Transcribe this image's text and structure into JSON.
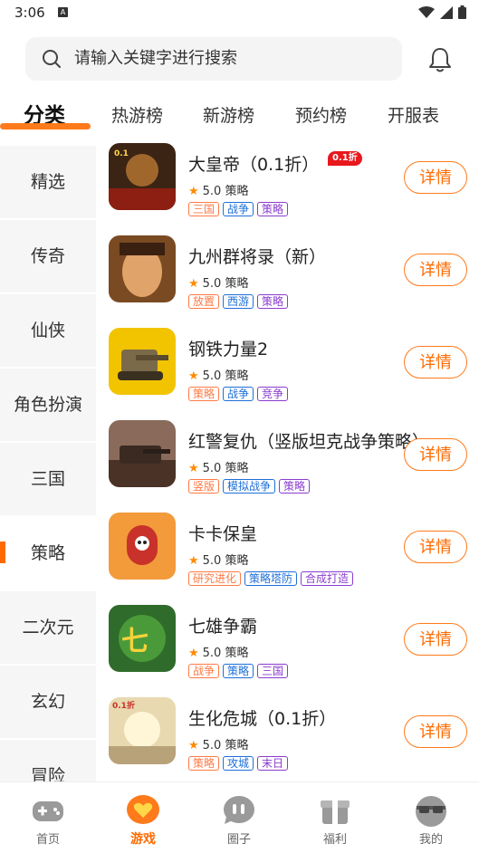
{
  "status_bar": {
    "time": "3:06",
    "notif": "A"
  },
  "search": {
    "placeholder": "请输入关键字进行搜索"
  },
  "top_tabs": [
    "分类",
    "热游榜",
    "新游榜",
    "预约榜",
    "开服表"
  ],
  "sidebar": {
    "items": [
      "精选",
      "传奇",
      "仙侠",
      "角色扮演",
      "三国",
      "策略",
      "二次元",
      "玄幻",
      "冒险"
    ],
    "active": "策略"
  },
  "games": [
    {
      "name": "大皇帝（0.1折）",
      "rating": "5.0",
      "genre": "策略",
      "badge": "0.1折",
      "tags": [
        {
          "text": "三国",
          "color": "#ff7a45"
        },
        {
          "text": "战争",
          "color": "#1e6fd9"
        },
        {
          "text": "策略",
          "color": "#8a3ccf"
        }
      ],
      "button": "详情",
      "icon_color": "#6b3a1e"
    },
    {
      "name": "九州群将录（新）",
      "rating": "5.0",
      "genre": "策略",
      "tags": [
        {
          "text": "放置",
          "color": "#ff7a45"
        },
        {
          "text": "西游",
          "color": "#1e6fd9"
        },
        {
          "text": "策略",
          "color": "#8a3ccf"
        }
      ],
      "button": "详情",
      "icon_color": "#c98a4a"
    },
    {
      "name": "钢铁力量2",
      "rating": "5.0",
      "genre": "策略",
      "tags": [
        {
          "text": "策略",
          "color": "#ff7a45"
        },
        {
          "text": "战争",
          "color": "#1e6fd9"
        },
        {
          "text": "竞争",
          "color": "#8a3ccf"
        }
      ],
      "button": "详情",
      "icon_color": "#f2c400"
    },
    {
      "name": "红警复仇（竖版坦克战争策略）",
      "rating": "5.0",
      "genre": "策略",
      "tags": [
        {
          "text": "竖版",
          "color": "#ff7a45"
        },
        {
          "text": "模拟战争",
          "color": "#1e6fd9"
        },
        {
          "text": "策略",
          "color": "#8a3ccf"
        }
      ],
      "button": "详情",
      "icon_color": "#5a3a2a"
    },
    {
      "name": "卡卡保皇",
      "rating": "5.0",
      "genre": "策略",
      "tags": [
        {
          "text": "研究进化",
          "color": "#ff7a45"
        },
        {
          "text": "策略塔防",
          "color": "#1e6fd9"
        },
        {
          "text": "合成打造",
          "color": "#8a3ccf"
        }
      ],
      "button": "详情",
      "icon_color": "#f39a3a"
    },
    {
      "name": "七雄争霸",
      "rating": "5.0",
      "genre": "策略",
      "tags": [
        {
          "text": "战争",
          "color": "#ff7a45"
        },
        {
          "text": "策略",
          "color": "#1e6fd9"
        },
        {
          "text": "三国",
          "color": "#8a3ccf"
        }
      ],
      "button": "详情",
      "icon_color": "#2f6b2a"
    },
    {
      "name": "生化危城（0.1折）",
      "rating": "5.0",
      "genre": "策略",
      "tags": [
        {
          "text": "策略",
          "color": "#ff7a45"
        },
        {
          "text": "攻城",
          "color": "#1e6fd9"
        },
        {
          "text": "末日",
          "color": "#8a3ccf"
        }
      ],
      "button": "详情",
      "icon_color": "#e8d9b0"
    }
  ],
  "bottom_nav": [
    {
      "label": "首页",
      "icon": "gamepad-icon"
    },
    {
      "label": "游戏",
      "icon": "heart-chat-icon",
      "active": true
    },
    {
      "label": "圈子",
      "icon": "chat-bubble-icon"
    },
    {
      "label": "福利",
      "icon": "gift-icon"
    },
    {
      "label": "我的",
      "icon": "avatar-glasses-icon"
    }
  ],
  "colors": {
    "accent": "#ff7a1a",
    "badge": "#e8181d"
  }
}
